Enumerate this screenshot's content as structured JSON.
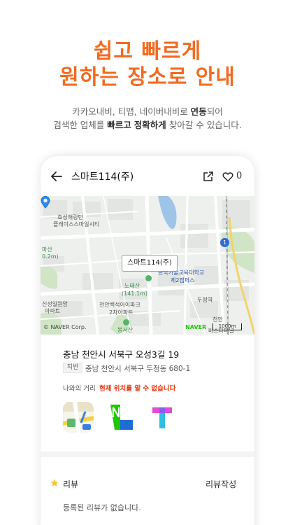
{
  "promo": {
    "headline_line1": "쉽고 빠르게",
    "headline_line2": "원하는 장소로 안내",
    "desc_line1": {
      "part1": "카카오내비, 티맵, 네이버내비로 ",
      "emph1": "연동",
      "part2": "되어"
    },
    "desc_line2": {
      "part1": "검색한 업체를 ",
      "emph1": "빠르고",
      "part2": " ",
      "emph2": "정확하게",
      "part3": " 찾아갈 수 있습니다."
    },
    "accent_color": "#f26b21"
  },
  "appbar": {
    "title": "스마트114(주)",
    "like_count": "0",
    "icons": [
      "back-arrow-icon",
      "share-icon",
      "heart-icon"
    ]
  },
  "map": {
    "callout": "스마트114(주)",
    "labels": {
      "l1a": "효성해링턴",
      "l1b": "플레이스스마일시티",
      "l2a": "마산",
      "l2b": "0.2m)",
      "l3a": "노태산",
      "l3b": "(141.1m)",
      "l4a": "한국기술교육대학교",
      "l4b": "제2캠퍼스",
      "l5": "두정역",
      "l6a": "신성일원앙",
      "l6b": "아파트",
      "l7a": "천안백석아이파크",
      "l7b": "2차아파트",
      "l8": "봉서산",
      "l9a": "천안",
      "l9b": "버스터미널"
    },
    "route_number": "1",
    "copyright": "© NAVER Corp.",
    "brand": "NAVER",
    "scale": "1000m"
  },
  "place": {
    "address": "충남 천안시 서북구 오성3길 19",
    "jibun_badge": "지번",
    "jibun_address": "충남 천안시 서북구 두정동 680-1",
    "distance_label": "나와의 거리",
    "distance_value": "현재 위치를 알 수 없습니다",
    "distance_color": "#e8340f",
    "nav_apps": [
      "kakao-navi-icon",
      "naver-navi-icon",
      "tmap-icon"
    ]
  },
  "review": {
    "title": "리뷰",
    "write_label": "리뷰작성",
    "empty_text": "등록된 리뷰가 없습니다."
  }
}
